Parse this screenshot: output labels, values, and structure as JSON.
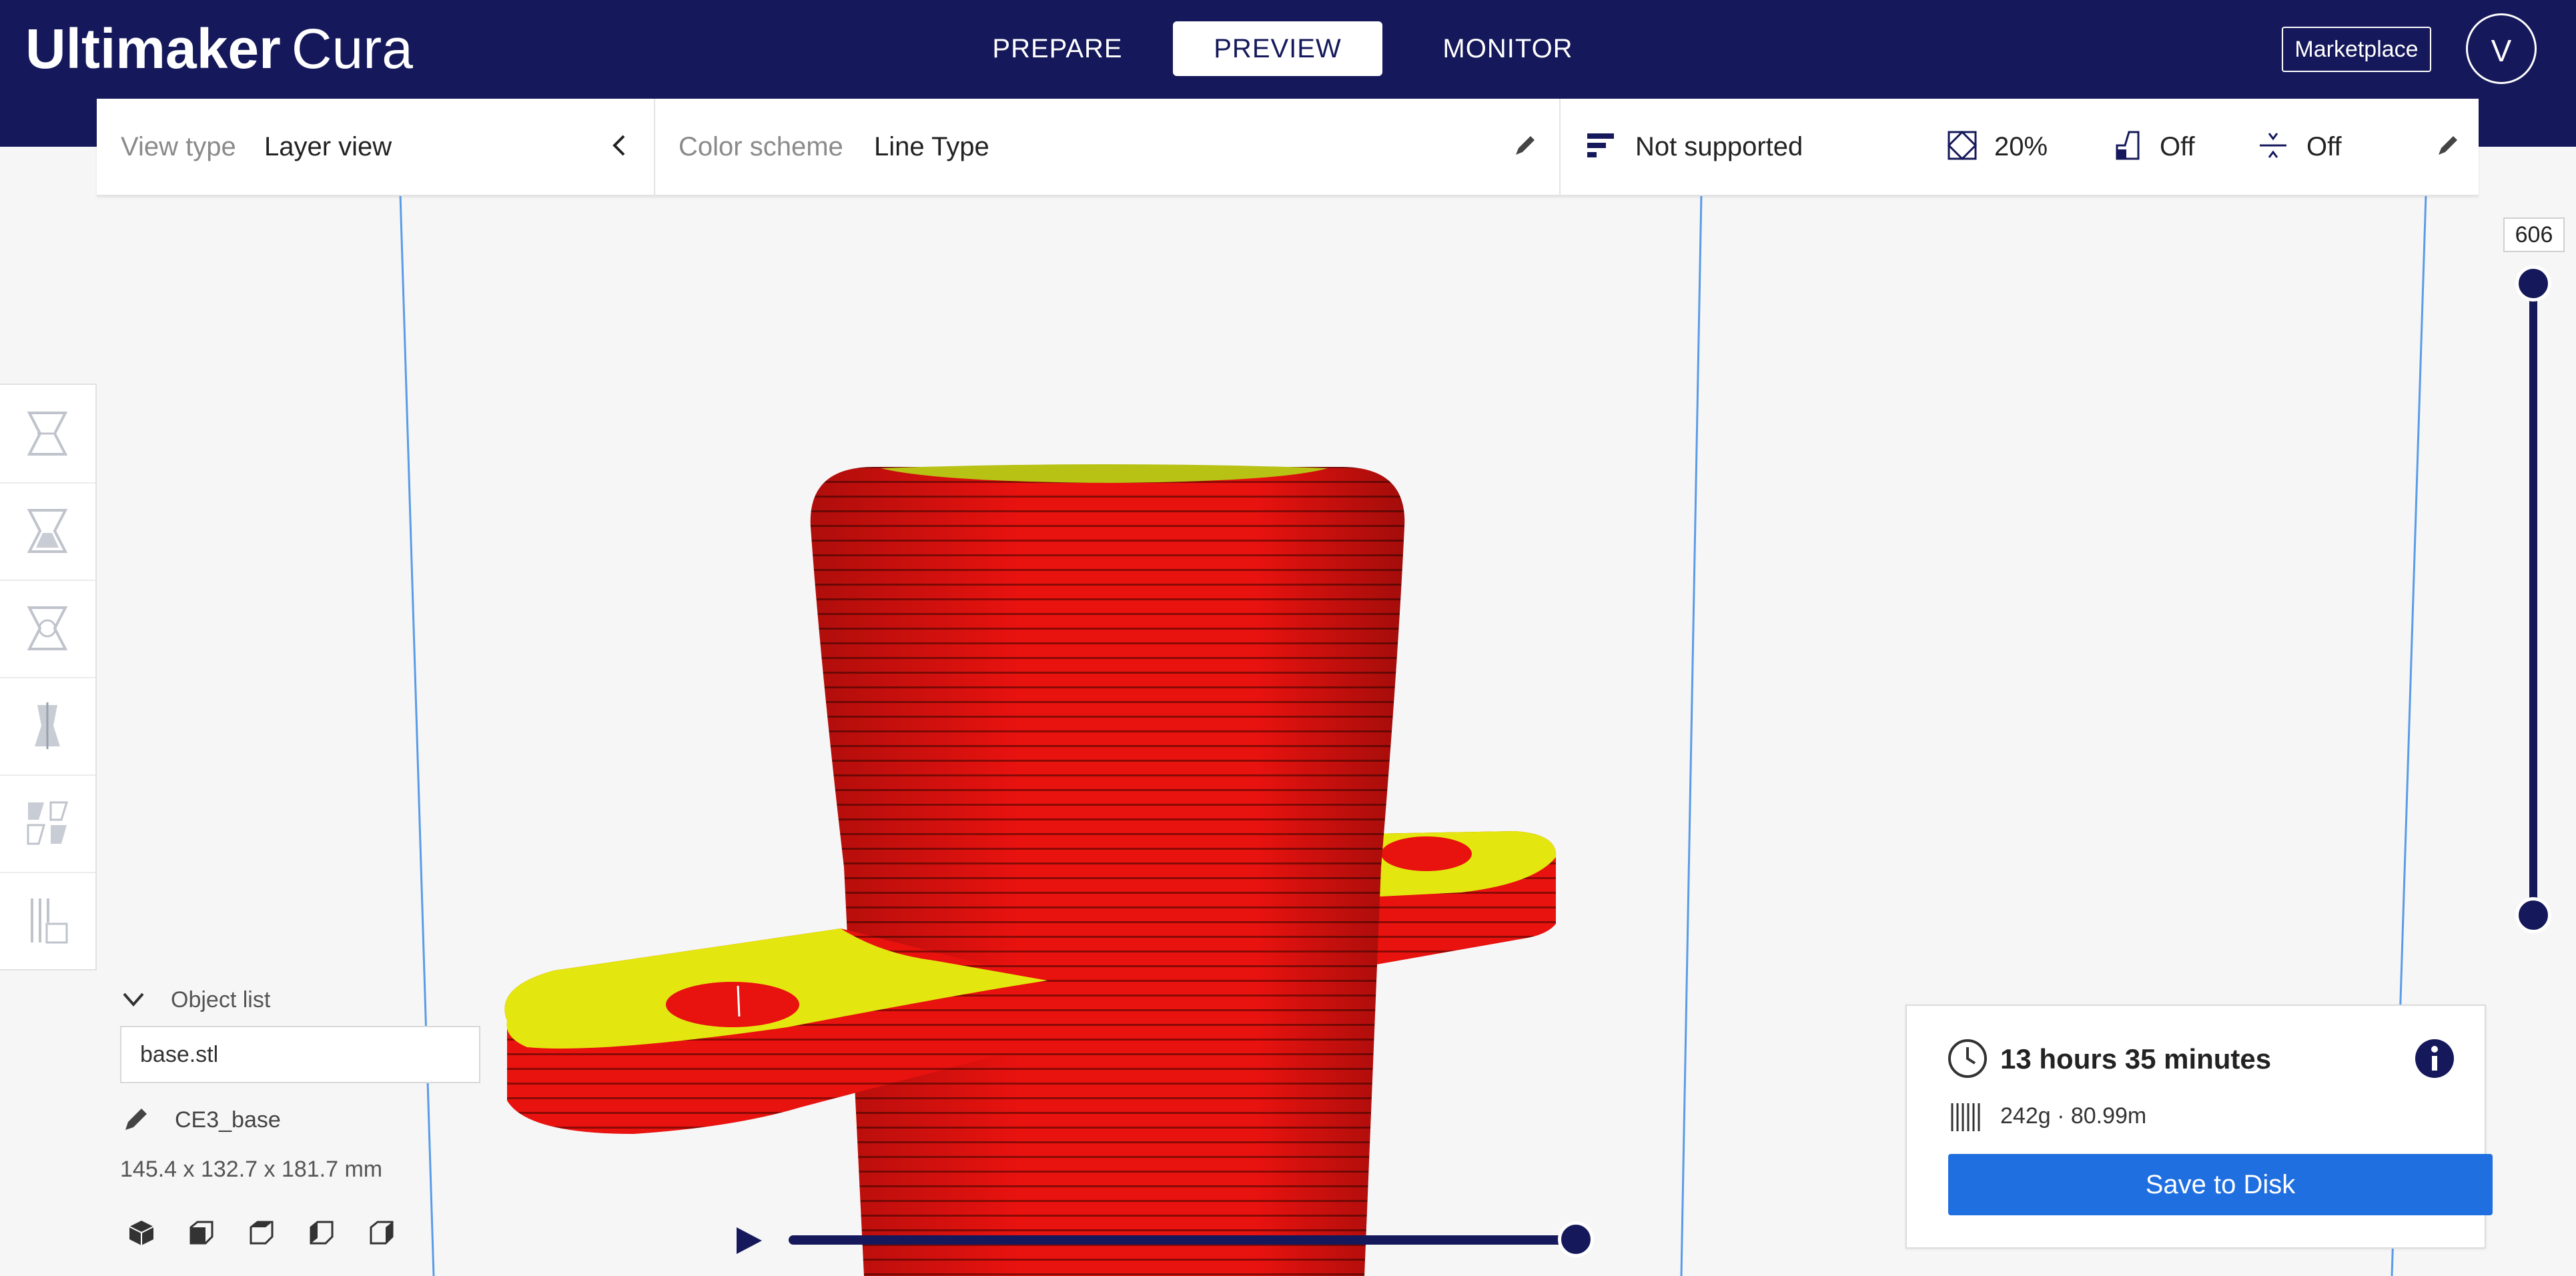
{
  "header": {
    "logo_brand": "Ultimaker",
    "logo_product": "Cura",
    "tabs": [
      {
        "label": "PREPARE",
        "active": false
      },
      {
        "label": "PREVIEW",
        "active": true
      },
      {
        "label": "MONITOR",
        "active": false
      }
    ],
    "marketplace_label": "Marketplace",
    "avatar_initial": "V"
  },
  "toolbar": {
    "view_type_label": "View type",
    "view_type_value": "Layer view",
    "color_scheme_label": "Color scheme",
    "color_scheme_value": "Line Type",
    "support_value": "Not supported",
    "infill_value": "20%",
    "support_toggle_value": "Off",
    "adhesion_value": "Off"
  },
  "tools": [
    {
      "name": "move-tool",
      "icon": "move-icon"
    },
    {
      "name": "scale-tool",
      "icon": "scale-icon"
    },
    {
      "name": "rotate-tool",
      "icon": "rotate-icon"
    },
    {
      "name": "mirror-tool",
      "icon": "mirror-icon"
    },
    {
      "name": "per-model-settings-tool",
      "icon": "per-model-settings-icon"
    },
    {
      "name": "support-blocker-tool",
      "icon": "support-blocker-icon"
    }
  ],
  "object_list": {
    "title": "Object list",
    "file_name": "base.stl",
    "object_name": "CE3_base",
    "dimensions": "145.4 x 132.7 x 181.7 mm"
  },
  "layer_slider": {
    "current_layer": "606",
    "min_layer": 1,
    "max_layer": 606
  },
  "playback": {
    "progress": 1.0
  },
  "print_info": {
    "time": "13 hours 35 minutes",
    "material": "242g · 80.99m",
    "save_label": "Save to Disk"
  },
  "colors": {
    "header_bg": "#15185a",
    "accent_blue": "#1f6fe0",
    "model_red": "#e8120f",
    "model_yellow": "#e4e60f",
    "grid_line": "#5a9be8"
  }
}
